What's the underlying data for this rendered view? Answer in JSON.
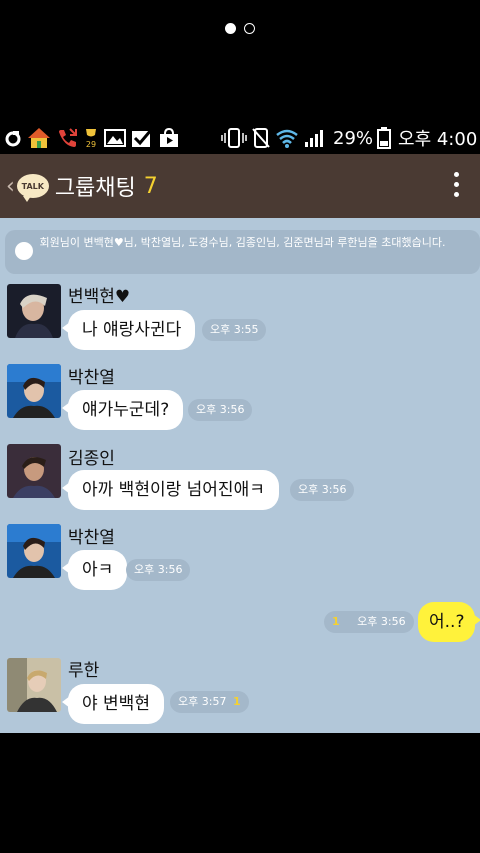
{
  "colors": {
    "header_bg": "#4a3a33",
    "chat_bg": "#b2c7d9",
    "my_bubble": "#fff23b",
    "other_bubble": "#ffffff",
    "unread": "#f5d130"
  },
  "status_bar": {
    "icons": [
      "carrier-icon",
      "home-icon",
      "missed-call-icon",
      "trophy-icon",
      "image-icon",
      "checkbox-icon",
      "store-icon",
      "vibrate-icon",
      "wifi-icon",
      "signal-icon",
      "battery-icon"
    ],
    "trophy_count": "29",
    "battery": "29%",
    "time": "오후 4:00"
  },
  "header": {
    "back": "‹",
    "talk_label": "TALK",
    "title": "그룹채팅",
    "member_count": "7"
  },
  "notice": {
    "text": "회원님이 변백현♥님, 박찬열님, 도경수님, 김종인님, 김준면님과 루한님을 초대했습니다."
  },
  "messages": [
    {
      "sender": "변백현♥",
      "text": "나 얘랑사귄다",
      "time": "오후 3:55",
      "unread": ""
    },
    {
      "sender": "박찬열",
      "text": "얘가누군데?",
      "time": "오후 3:56",
      "unread": ""
    },
    {
      "sender": "김종인",
      "text": "아까 백현이랑 넘어진애ㅋ",
      "time": "오후 3:56",
      "unread": ""
    },
    {
      "sender": "박찬열",
      "text": "아ㅋ",
      "time": "오후 3:56",
      "unread": ""
    },
    {
      "sender": "",
      "text": "어..?",
      "time": "오후 3:56",
      "unread": "1",
      "mine": true
    },
    {
      "sender": "루한",
      "text": "야 변백현",
      "time": "오후 3:57",
      "unread": "1"
    }
  ]
}
